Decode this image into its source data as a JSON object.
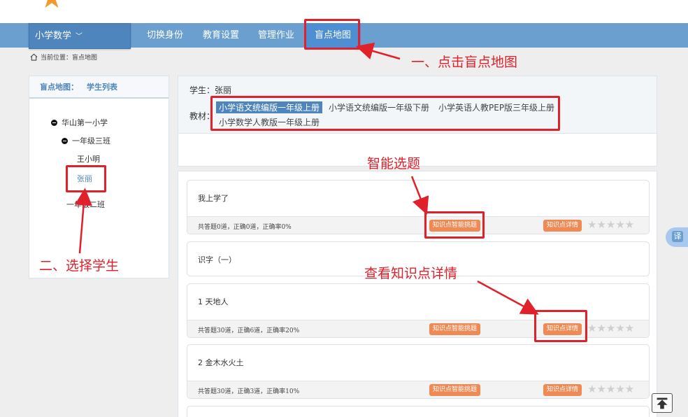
{
  "nav": {
    "subject_label": "小学数学",
    "items": [
      "切换身份",
      "教育设置",
      "管理作业",
      "盲点地图"
    ]
  },
  "breadcrumb": {
    "prefix": "当前位置：",
    "current": "盲点地图"
  },
  "left_panel": {
    "title": "盲点地图：",
    "subtitle": "学生列表",
    "tree": {
      "school": "华山第一小学",
      "class1": "一年级三班",
      "student1": "王小明",
      "student2": "张丽",
      "class2": "一年级二班"
    }
  },
  "student_info": {
    "student_line": "学生：张丽",
    "textbook_label": "教材：",
    "textbooks": [
      "小学语文统编版一年级上册",
      "小学语文统编版一年级下册",
      "小学英语人教PEP版三年级上册",
      "小学数学人教版一年级上册"
    ]
  },
  "lessons": [
    {
      "title": "我上学了",
      "stats": "共答题0道，正确0道，正确率0%"
    },
    {
      "title": "识字（一）"
    },
    {
      "title": "1 天地人",
      "stats": "共答题30道，正确6道，正确率20%"
    },
    {
      "title": "2 金木水火土",
      "stats": "共答题30道，正确3道，正确率10%"
    }
  ],
  "buttons": {
    "smart_select": "知识点智能挑题",
    "detail": "知识点详情"
  },
  "stars_text": "★★★★★",
  "annotations": {
    "step1": "一、点击盲点地图",
    "step2": "二、选择学生",
    "smart": "智能选题",
    "detail": "查看知识点详情"
  },
  "translate_label": "译",
  "colors": {
    "nav": "#6a9fd0",
    "accent": "#4f85bd",
    "button": "#ef8a55",
    "annotation": "#e0202a"
  }
}
